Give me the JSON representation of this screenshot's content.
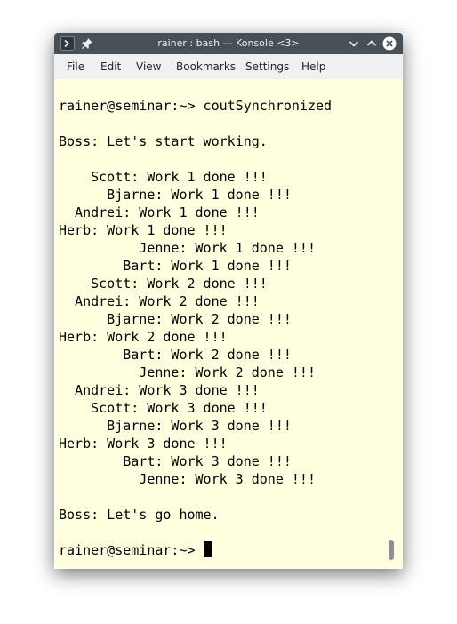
{
  "window": {
    "title": "rainer : bash — Konsole <3>"
  },
  "menu": [
    "File",
    "Edit",
    "View",
    "Bookmarks",
    "Settings",
    "Help"
  ],
  "terminal": {
    "lines": [
      "",
      "rainer@seminar:~> coutSynchronized",
      "",
      "Boss: Let's start working.",
      "",
      "    Scott: Work 1 done !!!",
      "      Bjarne: Work 1 done !!!",
      "  Andrei: Work 1 done !!!",
      "Herb: Work 1 done !!!",
      "          Jenne: Work 1 done !!!",
      "        Bart: Work 1 done !!!",
      "    Scott: Work 2 done !!!",
      "  Andrei: Work 2 done !!!",
      "      Bjarne: Work 2 done !!!",
      "Herb: Work 2 done !!!",
      "        Bart: Work 2 done !!!",
      "          Jenne: Work 2 done !!!",
      "  Andrei: Work 3 done !!!",
      "    Scott: Work 3 done !!!",
      "      Bjarne: Work 3 done !!!",
      "Herb: Work 3 done !!!",
      "        Bart: Work 3 done !!!",
      "          Jenne: Work 3 done !!!",
      "",
      "Boss: Let's go home.",
      "",
      "rainer@seminar:~> "
    ]
  },
  "icons": {
    "terminal": "terminal-icon",
    "pin": "pin-icon",
    "minimize": "chevron-down-icon",
    "maximize": "chevron-up-icon",
    "close": "close-icon"
  },
  "colors": {
    "titlebar": "#475057",
    "menubar": "#eff0f1",
    "terminal_bg": "#ffffe0",
    "text": "#000000",
    "close_button": "#ffffff"
  }
}
